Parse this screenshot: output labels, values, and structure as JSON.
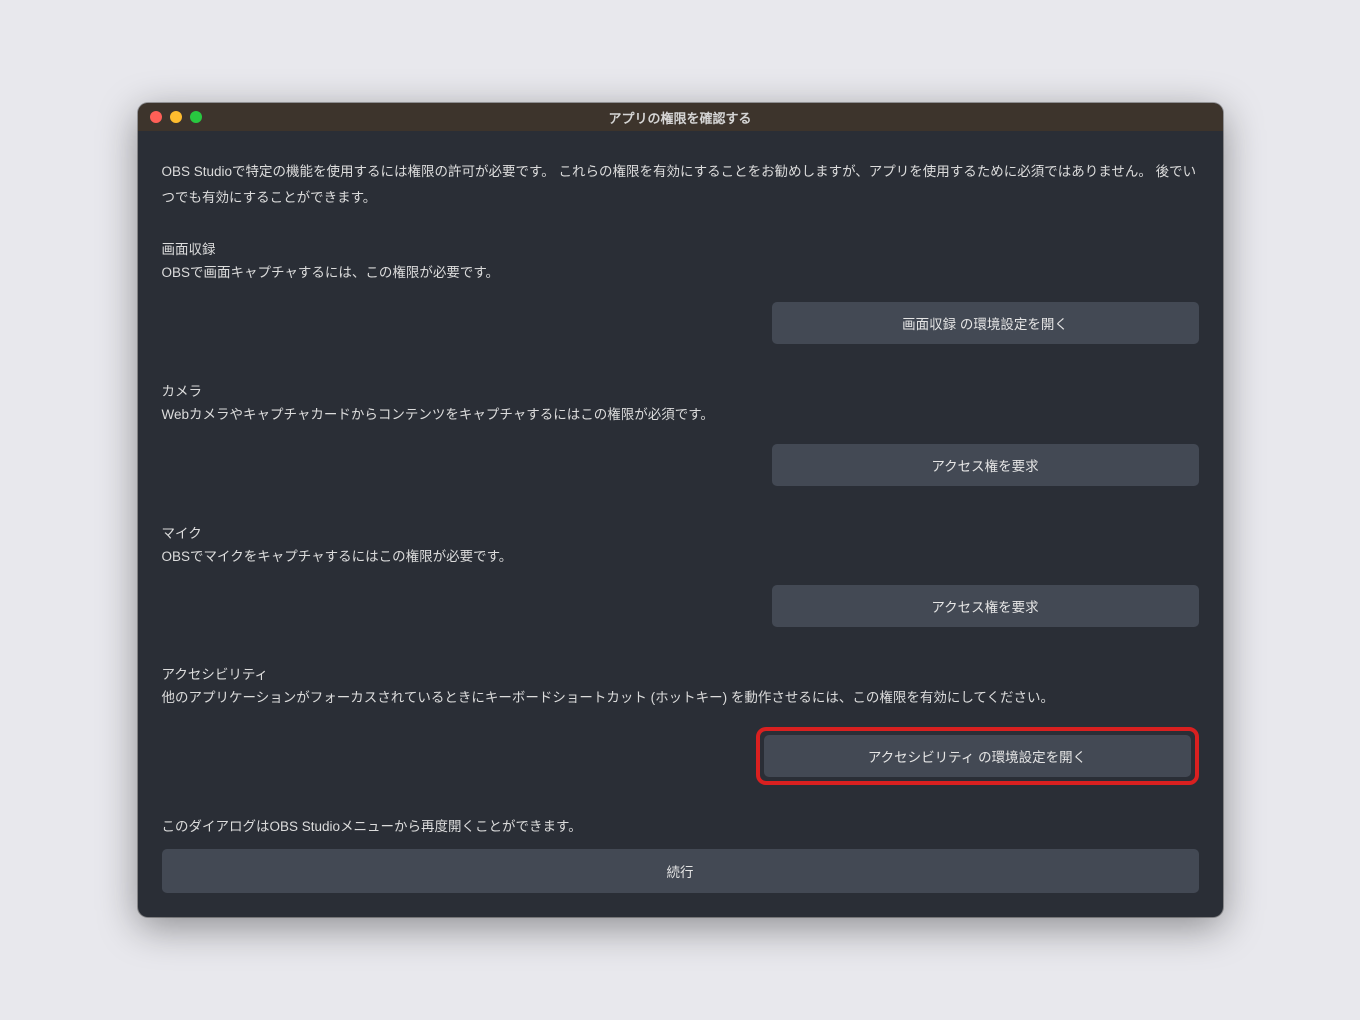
{
  "window": {
    "title": "アプリの権限を確認する",
    "intro": "OBS Studioで特定の機能を使用するには権限の許可が必要です。 これらの権限を有効にすることをお勧めしますが、アプリを使用するために必須ではありません。 後でいつでも有効にすることができます。"
  },
  "sections": {
    "screenRecording": {
      "title": "画面収録",
      "desc": "OBSで画面キャプチャするには、この権限が必要です。",
      "button": "画面収録 の環境設定を開く"
    },
    "camera": {
      "title": "カメラ",
      "desc": "Webカメラやキャプチャカードからコンテンツをキャプチャするにはこの権限が必須です。",
      "button": "アクセス権を要求"
    },
    "microphone": {
      "title": "マイク",
      "desc": "OBSでマイクをキャプチャするにはこの権限が必要です。",
      "button": "アクセス権を要求"
    },
    "accessibility": {
      "title": "アクセシビリティ",
      "desc": "他のアプリケーションがフォーカスされているときにキーボードショートカット (ホットキー) を動作させるには、この権限を有効にしてください。",
      "button": "アクセシビリティ の環境設定を開く"
    }
  },
  "footer": {
    "note": "このダイアログはOBS Studioメニューから再度開くことができます。",
    "continue": "続行"
  }
}
